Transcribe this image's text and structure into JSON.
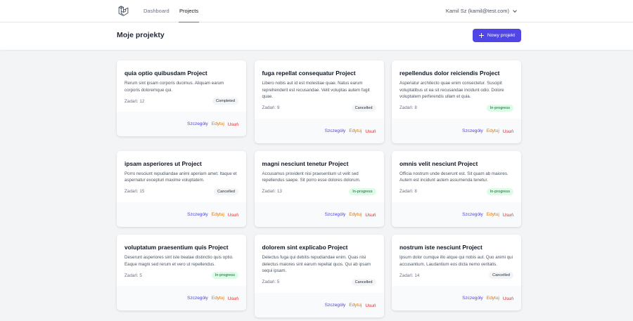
{
  "nav": {
    "links": [
      {
        "label": "Dashboard",
        "active": false
      },
      {
        "label": "Projects",
        "active": true
      }
    ],
    "user": "Kamil Sz (kamil@test.com)"
  },
  "header": {
    "title": "Moje projekty",
    "new_button": "Nowy projekt"
  },
  "actions": {
    "details": "Szczegóły",
    "edit": "Edytuj",
    "delete": "Usuń"
  },
  "colors": {
    "accent": "#4f46e5",
    "edit": "#d97706",
    "delete": "#dc2626"
  },
  "projects": [
    {
      "title": "quia optio quibusdam Project",
      "description": "Rerum sint ipsam corporis ducimus. Aliquam earum corporis doloremque qui.",
      "tasks": "Zadań: 12",
      "status": "Completed"
    },
    {
      "title": "fuga repellat consequatur Project",
      "description": "Libero nobis aut id est molestiae quae. Natus earum reprehenderit est recusandae. Velit voluptas autem fugit quae.",
      "tasks": "Zadań: 9",
      "status": "Cancelled"
    },
    {
      "title": "repellendus dolor reiciendis Project",
      "description": "Asperiatur architecto quae enim consectetur. Suscipit voluptatibus ut ea sit recusandae incidunt odio. Dolore voluptatem perferendis ullam et quia.",
      "tasks": "Zadań: 8",
      "status": "In-progress"
    },
    {
      "title": "ipsam asperiores ut Project",
      "description": "Porro nesciunt repudiandae animi aperiam amet. Itaque et aspernatur excepturi maxime voluptatem.",
      "tasks": "Zadań: 15",
      "status": "Cancelled"
    },
    {
      "title": "magni nesciunt tenetur Project",
      "description": "Accusamus provident nisi praesentium ut velit sed repellendus saepe. Sit porro esse dolores dolorum.",
      "tasks": "Zadań: 13",
      "status": "In-progress"
    },
    {
      "title": "omnis velit nesciunt Project",
      "description": "Officia nostrum unde deserunt est. Sit quam ab maiores. Autem est incidunt autem assumenda tenetur.",
      "tasks": "Zadań: 8",
      "status": "In-progress"
    },
    {
      "title": "voluptatum praesentium quis Project",
      "description": "Deserunt asperiores sint iste beatae distinctio quis optio. Eaque magni sed rerum et vero ut repellendus.",
      "tasks": "Zadań: 5",
      "status": "In-progress"
    },
    {
      "title": "dolorem sint explicabo Project",
      "description": "Delectus fuga qui debitis repudiandae enim. Quas nisi delectus maiores sint earum repellat quos. Qui ab ipsam sequi ipsam.",
      "tasks": "Zadań: 5",
      "status": "Cancelled"
    },
    {
      "title": "nostrum iste nesciunt Project",
      "description": "Ipsum dolor cumque illo atque qui nobis aut. Quo animi qui accusantium. Laudantium eos dicta nemo veritatis.",
      "tasks": "Zadań: 14",
      "status": "Cancelled"
    }
  ]
}
